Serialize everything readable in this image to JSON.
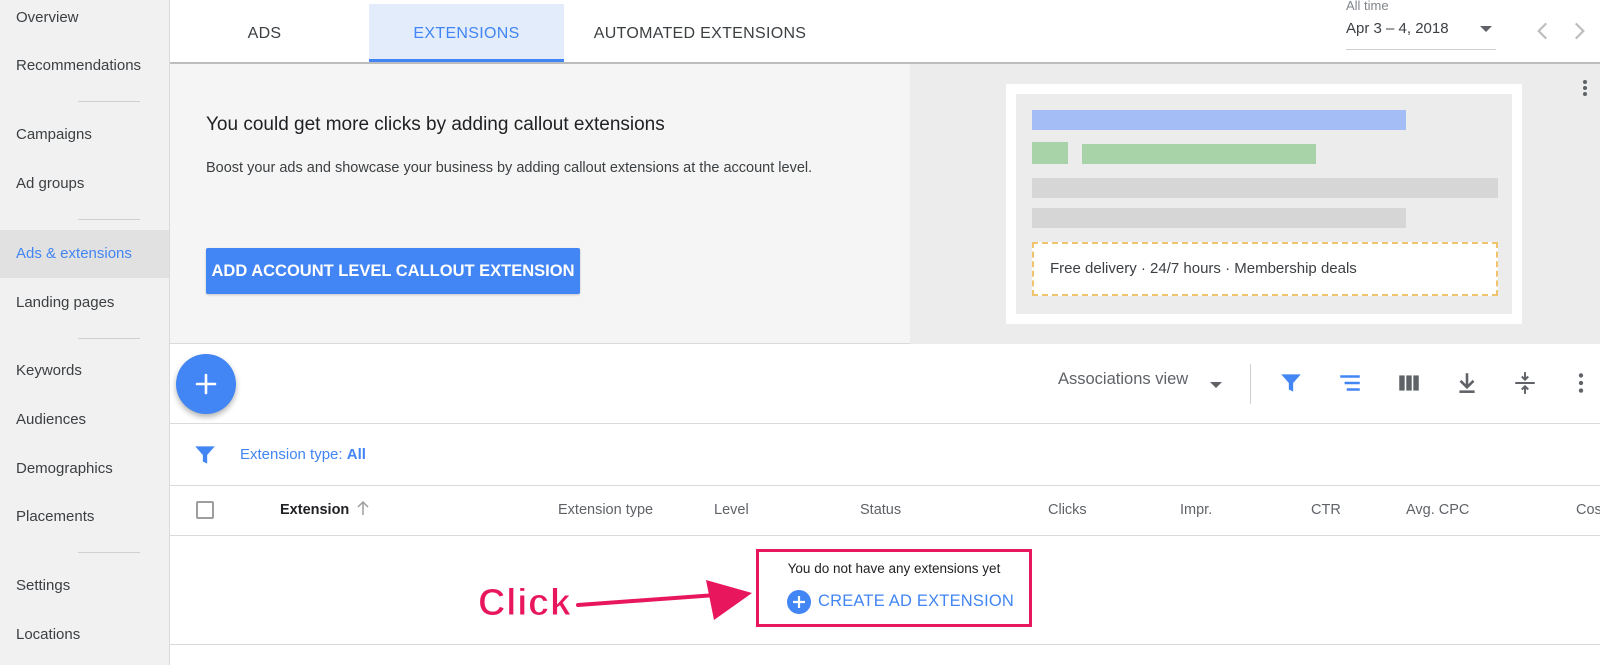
{
  "sidebar": {
    "items": [
      {
        "label": "Overview"
      },
      {
        "label": "Recommendations"
      },
      {
        "label": "Campaigns"
      },
      {
        "label": "Ad groups"
      },
      {
        "label": "Ads & extensions",
        "active": true
      },
      {
        "label": "Landing pages"
      },
      {
        "label": "Keywords"
      },
      {
        "label": "Audiences"
      },
      {
        "label": "Demographics"
      },
      {
        "label": "Placements"
      },
      {
        "label": "Settings"
      },
      {
        "label": "Locations"
      }
    ]
  },
  "tabs": [
    {
      "label": "ADS"
    },
    {
      "label": "EXTENSIONS",
      "active": true
    },
    {
      "label": "AUTOMATED EXTENSIONS"
    }
  ],
  "date": {
    "caption": "All time",
    "range": "Apr 3 – 4, 2018"
  },
  "promo": {
    "title": "You could get more clicks by adding callout extensions",
    "description": "Boost your ads and showcase your business by adding callout extensions at the account level.",
    "button": "ADD ACCOUNT LEVEL CALLOUT EXTENSION",
    "preview_callouts": "Free delivery ·  24/7 hours ·  Membership deals"
  },
  "toolbar": {
    "view_selector": "Associations view",
    "icons": [
      "filter-icon",
      "segment-icon",
      "columns-icon",
      "download-icon",
      "expand-icon",
      "more-icon"
    ]
  },
  "filter": {
    "label": "Extension type:",
    "value": "All"
  },
  "table": {
    "columns": [
      "Extension",
      "Extension type",
      "Level",
      "Status",
      "Clicks",
      "Impr.",
      "CTR",
      "Avg. CPC",
      "Cos"
    ]
  },
  "empty_state": {
    "message": "You do not have any extensions yet",
    "action": "CREATE AD EXTENSION"
  },
  "annotation": {
    "label": "Click"
  },
  "colors": {
    "accent": "#4285f4",
    "annotation": "#e8175d",
    "preview_title_bar": "#a4bdf7",
    "preview_url_bar": "#a8d3a8",
    "preview_text_bar": "#d6d6d6",
    "preview_callout_border": "#f0c36d"
  }
}
